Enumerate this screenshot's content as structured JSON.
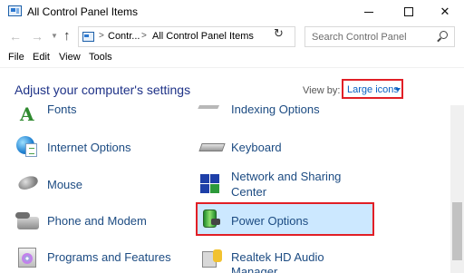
{
  "window": {
    "title": "All Control Panel Items",
    "controls": {
      "minimize": "",
      "maximize": "",
      "close": "✕"
    }
  },
  "address_bar": {
    "back_icon": "back-arrow",
    "forward_icon": "forward-arrow",
    "breadcrumbs": [
      "Contr...",
      "All Control Panel Items"
    ],
    "separators": [
      ">",
      ">"
    ],
    "search_placeholder": "Search Control Panel"
  },
  "menu": {
    "items": [
      "File",
      "Edit",
      "View",
      "Tools"
    ]
  },
  "header": {
    "title": "Adjust your computer's settings",
    "view_by_label": "View by:",
    "view_by_value": "Large icons"
  },
  "items": {
    "left": [
      "Fonts",
      "Internet Options",
      "Mouse",
      "Phone and Modem",
      "Programs and Features"
    ],
    "right": [
      "Indexing Options",
      "Keyboard",
      "Network and Sharing Center",
      "Power Options",
      "Realtek HD Audio Manager"
    ],
    "right_multiline": {
      "network_line1": "Network and Sharing",
      "network_line2": "Center"
    }
  },
  "colors": {
    "link": "#1c4b82",
    "header_title": "#1e3287",
    "highlight_border": "#e11f26",
    "selected_bg": "#cce8ff"
  }
}
